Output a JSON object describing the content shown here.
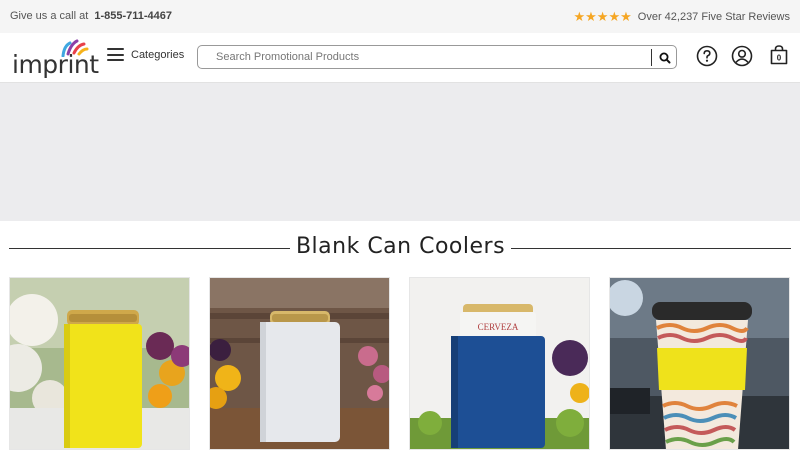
{
  "topbar": {
    "call_text": "Give us a call at",
    "phone": "1-855-711-4467",
    "rating_stars": 5,
    "reviews_text": "Over 42,237 Five Star Reviews",
    "star_color": "#f5a623"
  },
  "header": {
    "logo_text": "imprint",
    "categories_label": "Categories",
    "search_placeholder": "Search Promotional Products",
    "cart_count": "0",
    "icons": [
      "menu-icon",
      "search-icon",
      "help-icon",
      "account-icon",
      "cart-icon"
    ]
  },
  "section": {
    "title": "Blank Can Coolers"
  },
  "products": [
    {
      "name": "yellow-foam-can-cooler",
      "color": "#f1e31a"
    },
    {
      "name": "white-foam-can-cooler",
      "color": "#e6e8ec"
    },
    {
      "name": "blue-foam-can-cooler",
      "color": "#1d4f95"
    },
    {
      "name": "yellow-cup-sleeve",
      "color": "#efe21b"
    }
  ]
}
